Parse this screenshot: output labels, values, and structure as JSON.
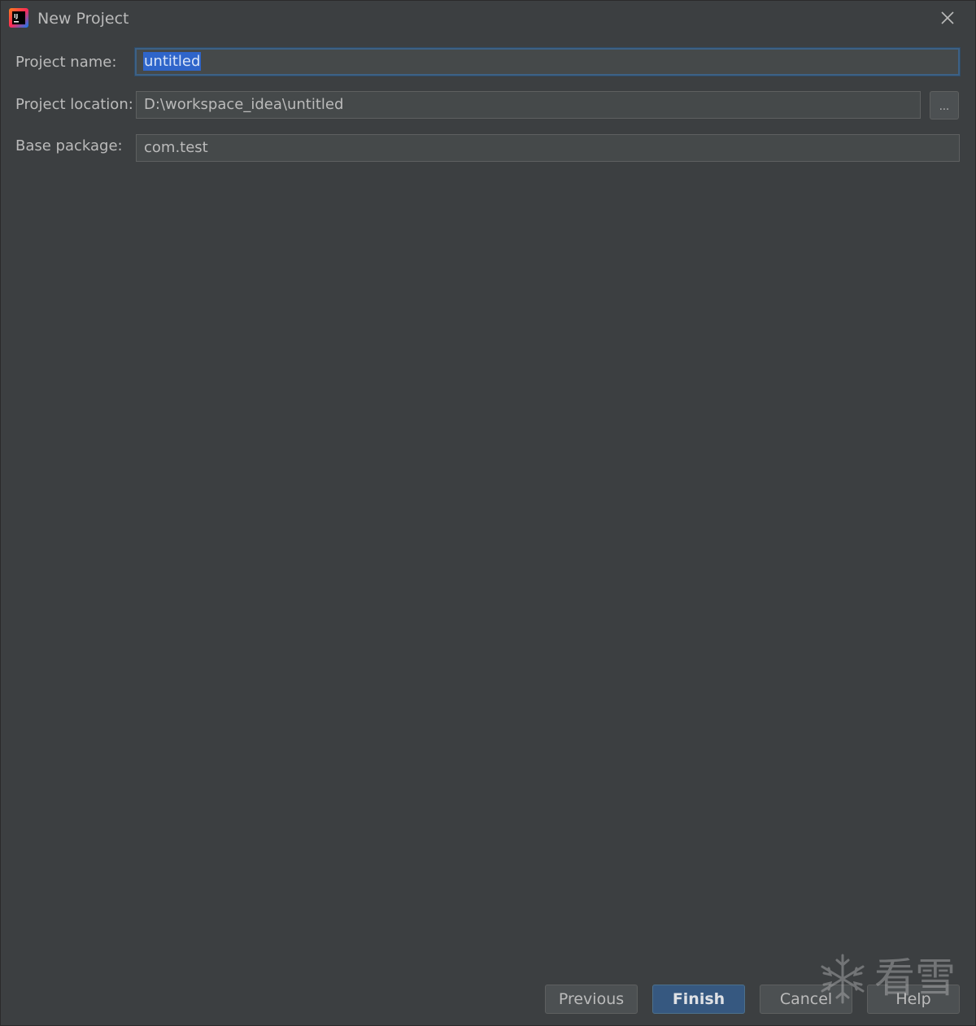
{
  "window": {
    "title": "New Project"
  },
  "form": {
    "project_name": {
      "label": "Project name:",
      "value": "untitled"
    },
    "project_location": {
      "label": "Project location:",
      "value": "D:\\workspace_idea\\untitled",
      "browse_label": "..."
    },
    "base_package": {
      "label": "Base package:",
      "value": "com.test"
    }
  },
  "buttons": {
    "previous": "Previous",
    "finish": "Finish",
    "cancel": "Cancel",
    "help": "Help"
  },
  "watermark": {
    "text": "看雪"
  },
  "colors": {
    "background": "#3c3f41",
    "field_bg": "#45494a",
    "focus_border": "#3d6185",
    "selection": "#2f65ca",
    "default_button": "#365880"
  },
  "icons": {
    "app": "intellij-idea-icon",
    "close": "close-icon",
    "watermark": "snowflake-icon"
  }
}
